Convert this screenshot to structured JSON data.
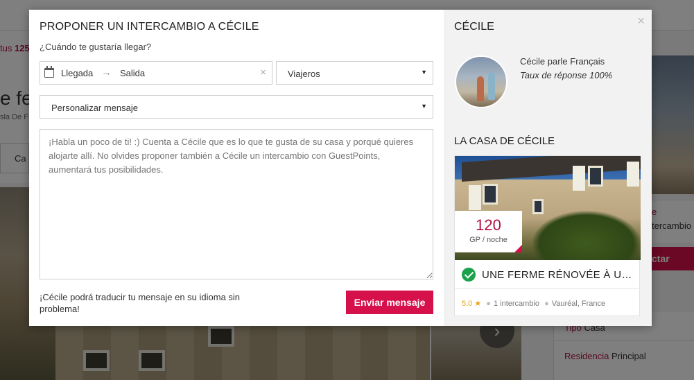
{
  "background": {
    "status_prefix": "tus",
    "status_number": "125",
    "title_fragment": "e fer",
    "subtitle_fragment": "sla De F",
    "tab_fragment": "Ca",
    "right_text_1": "e",
    "right_text_2": "tercambio",
    "contact_label": "ctar",
    "info_rows": [
      {
        "key": "Tipo",
        "value": "Casa"
      },
      {
        "key": "Residencia",
        "value": "Principal"
      }
    ]
  },
  "modal": {
    "title": "PROPONER UN INTERCAMBIO A CÉCILE",
    "question": "¿Cuándo te gustaría llegar?",
    "date": {
      "checkin": "Llegada",
      "arrow": "→",
      "checkout": "Salida",
      "clear": "×"
    },
    "travelers_select": {
      "selected": "Viajeros"
    },
    "message_select": {
      "selected": "Personalizar mensaje"
    },
    "message_placeholder": "¡Habla un poco de ti! :) Cuenta a Cécile que es lo que te gusta de su casa y porqué quieres alojarte allí. No olvides proponer también a Cécile un intercambio con GuestPoints, aumentará tus posibilidades.",
    "translate_note": "¡Cécile podrá traducir tu mensaje en su idioma sin problema!",
    "send_label": "Enviar mensaje",
    "close": "×"
  },
  "host": {
    "name": "CÉCILE",
    "language": "Cécile parle Français",
    "response_rate": "Taux de réponse 100%",
    "house_heading": "LA CASA DE CÉCILE"
  },
  "listing": {
    "price": "120",
    "price_unit": "GP / noche",
    "title": "UNE FERME RÉNOVÉE À UNE ...",
    "rating": "5.0",
    "exchanges": "1 intercambio",
    "location": "Vauréal, France"
  },
  "colors": {
    "accent": "#d5104a",
    "price": "#b0103f",
    "verified": "#1aa34a",
    "star": "#e8a317"
  }
}
